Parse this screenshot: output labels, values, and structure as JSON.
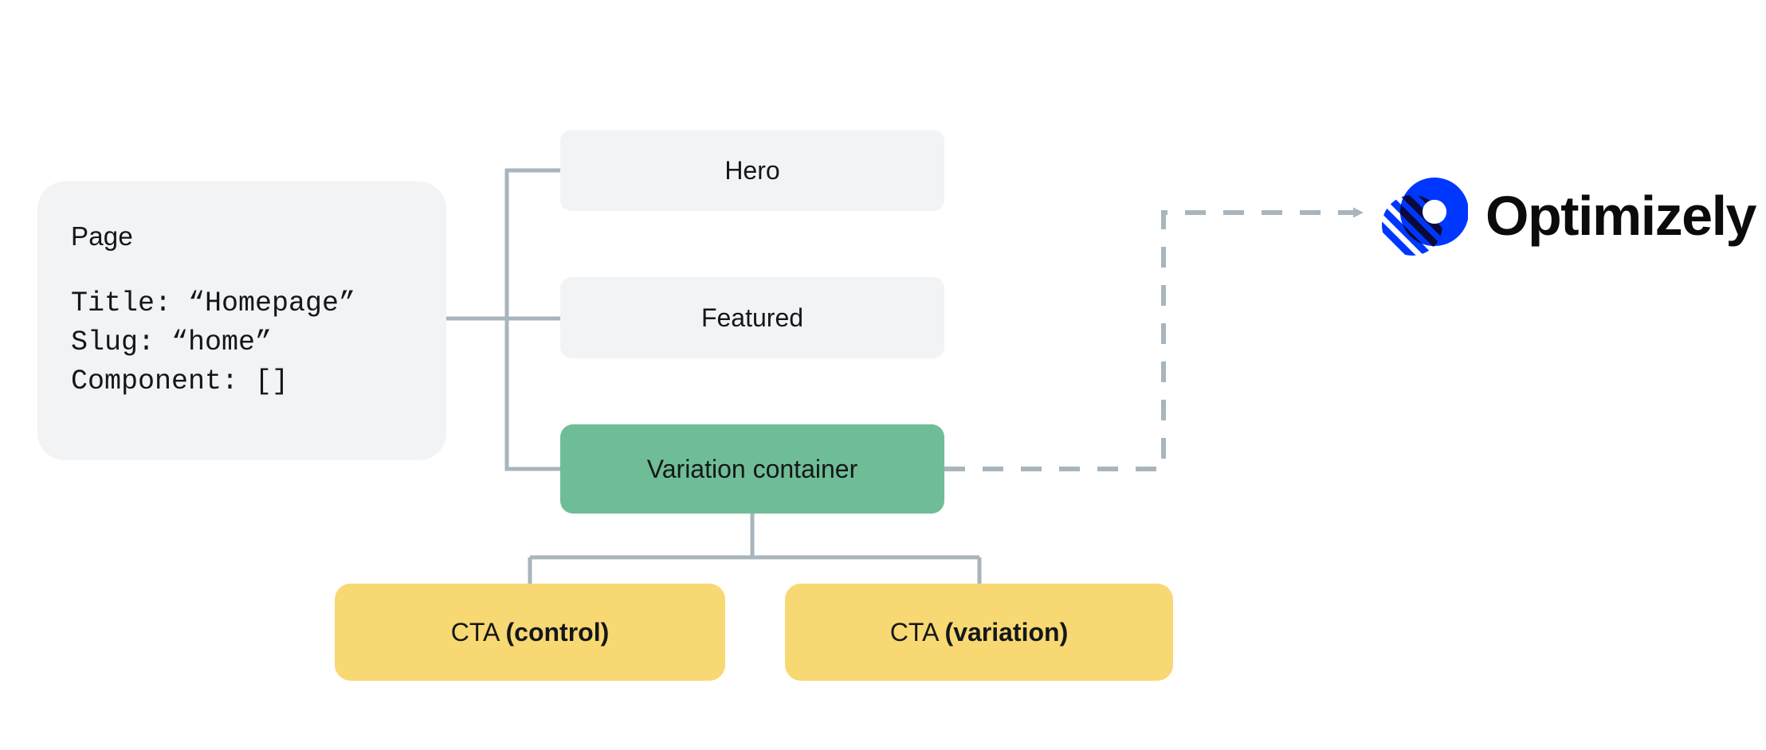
{
  "diagram": {
    "title": "Optimizely variation container component tree",
    "colors": {
      "background": "#ffffff",
      "card_gray": "#f2f3f4",
      "node_green": "#6fbd96",
      "node_yellow": "#f8d872",
      "connector": "#a8b5bd",
      "text": "#14171a",
      "logo_blue": "#0037ff",
      "logo_navy": "#0a0a3c",
      "logo_black": "#0b0b0d"
    }
  },
  "page_card": {
    "title": "Page",
    "code": "Title: “Homepage”\nSlug: “home”\nComponent: []",
    "fields": [
      {
        "key": "Title",
        "value": "“Homepage”"
      },
      {
        "key": "Slug",
        "value": "“home”"
      },
      {
        "key": "Component",
        "value": "[]"
      }
    ]
  },
  "nodes": [
    {
      "id": "hero",
      "label": "Hero",
      "color": "#f2f3f4"
    },
    {
      "id": "featured",
      "label": "Featured",
      "color": "#f2f3f4"
    },
    {
      "id": "variation_container",
      "label": "Variation container",
      "color": "#6fbd96"
    }
  ],
  "cta_nodes": [
    {
      "id": "cta_control",
      "label_regular": "CTA ",
      "label_bold": "(control)",
      "color": "#f8d872"
    },
    {
      "id": "cta_variation",
      "label_regular": "CTA ",
      "label_bold": "(variation)",
      "color": "#f8d872"
    }
  ],
  "logo": {
    "wordmark": "Optimizely",
    "mark_name": "optimizely-logo-icon"
  },
  "connectors": {
    "tree_style": "solid",
    "integration_style": "dashed",
    "note_arrow_target": "Component: []"
  }
}
